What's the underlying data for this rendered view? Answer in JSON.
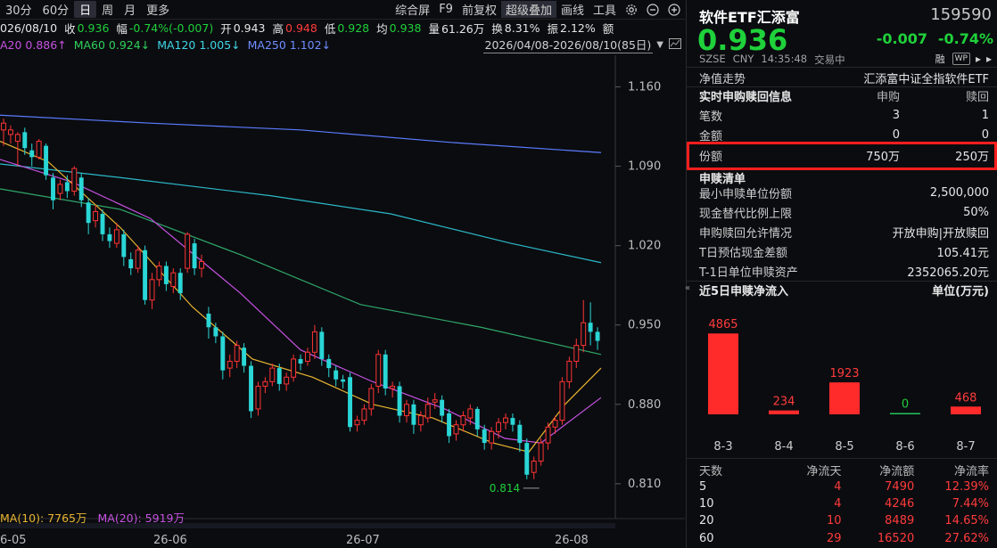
{
  "toolbar": {
    "left_items": [
      "30分",
      "60分",
      "日",
      "周",
      "月",
      "更多"
    ],
    "active_index": 2,
    "right_items": [
      "综合屏",
      "F9",
      "前复权",
      "超级叠加",
      "画线",
      "工具"
    ],
    "highlight_index": 3
  },
  "quote": {
    "date": "026/08/10",
    "close_label": "收",
    "close": "0.936",
    "amp_label": "幅",
    "amp": "-0.74%(-0.007)",
    "open_label": "开",
    "open": "0.943",
    "high_label": "高",
    "high": "0.948",
    "low_label": "低",
    "low": "0.928",
    "avg_label": "均",
    "avg": "0.938",
    "vol_label": "量",
    "vol": "61.26万",
    "turn_label": "换",
    "turn": "8.31%",
    "swing_label": "振",
    "swing": "2.12%",
    "amount_label": "额"
  },
  "ma": {
    "ma20": "A20 0.886↑",
    "ma60": "MA60 0.924↓",
    "ma120": "MA120 1.005↓",
    "ma250": "MA250 1.102↓",
    "range": "2026/04/08-2026/08/10(85日)"
  },
  "volume_ma": {
    "ma10": "MA(10): 7765万",
    "ma20": "MA(20): 5919万"
  },
  "chart_data": {
    "type": "candlestick",
    "y_ticks": [
      "1.160",
      "1.090",
      "1.020",
      "0.950",
      "0.880",
      "0.810"
    ],
    "x_ticks": [
      "6-05",
      "26-06",
      "26-07",
      "26-08"
    ],
    "low_marker": "0.814",
    "ylim": [
      0.795,
      1.18
    ],
    "candles": [
      [
        1.122,
        1.128,
        1.108,
        1.132
      ],
      [
        1.118,
        1.122,
        1.11,
        1.126
      ],
      [
        1.112,
        1.118,
        1.09,
        1.12
      ],
      [
        1.12,
        1.106,
        1.1,
        1.124
      ],
      [
        1.104,
        1.098,
        1.09,
        1.11
      ],
      [
        1.098,
        1.112,
        1.096,
        1.114
      ],
      [
        1.108,
        1.082,
        1.078,
        1.11
      ],
      [
        1.08,
        1.06,
        1.052,
        1.084
      ],
      [
        1.066,
        1.074,
        1.06,
        1.078
      ],
      [
        1.076,
        1.068,
        1.062,
        1.082
      ],
      [
        1.068,
        1.088,
        1.064,
        1.09
      ],
      [
        1.08,
        1.06,
        1.054,
        1.084
      ],
      [
        1.058,
        1.04,
        1.03,
        1.062
      ],
      [
        1.042,
        1.05,
        1.036,
        1.056
      ],
      [
        1.048,
        1.03,
        1.024,
        1.052
      ],
      [
        1.03,
        1.024,
        1.018,
        1.036
      ],
      [
        1.022,
        1.034,
        1.018,
        1.04
      ],
      [
        1.03,
        1.01,
        1.002,
        1.034
      ],
      [
        1.008,
        1.0,
        0.994,
        1.014
      ],
      [
        1.0,
        1.016,
        0.996,
        1.02
      ],
      [
        1.016,
        0.972,
        0.968,
        1.02
      ],
      [
        0.972,
        0.99,
        0.964,
        0.996
      ],
      [
        0.99,
        1.002,
        0.984,
        1.006
      ],
      [
        1.002,
        0.986,
        0.98,
        1.006
      ],
      [
        0.984,
        0.996,
        0.978,
        1.0
      ],
      [
        0.996,
        0.978,
        0.972,
        1.0
      ],
      [
        1.0,
        1.03,
        0.996,
        1.032
      ],
      [
        1.022,
        1.0,
        0.994,
        1.026
      ],
      [
        1.0,
        1.006,
        0.992,
        1.012
      ],
      [
        0.96,
        0.948,
        0.938,
        0.966
      ],
      [
        0.948,
        0.94,
        0.934,
        0.952
      ],
      [
        0.94,
        0.91,
        0.902,
        0.944
      ],
      [
        0.912,
        0.918,
        0.904,
        0.924
      ],
      [
        0.918,
        0.932,
        0.912,
        0.936
      ],
      [
        0.93,
        0.914,
        0.908,
        0.934
      ],
      [
        0.914,
        0.874,
        0.868,
        0.918
      ],
      [
        0.876,
        0.896,
        0.87,
        0.9
      ],
      [
        0.896,
        0.9,
        0.89,
        0.904
      ],
      [
        0.9,
        0.912,
        0.896,
        0.916
      ],
      [
        0.912,
        0.898,
        0.892,
        0.916
      ],
      [
        0.898,
        0.904,
        0.892,
        0.908
      ],
      [
        0.904,
        0.92,
        0.9,
        0.924
      ],
      [
        0.92,
        0.916,
        0.91,
        0.924
      ],
      [
        0.918,
        0.926,
        0.914,
        0.93
      ],
      [
        0.926,
        0.944,
        0.92,
        0.95
      ],
      [
        0.944,
        0.92,
        0.914,
        0.948
      ],
      [
        0.92,
        0.912,
        0.904,
        0.924
      ],
      [
        0.91,
        0.902,
        0.896,
        0.914
      ],
      [
        0.902,
        0.9,
        0.894,
        0.906
      ],
      [
        0.904,
        0.86,
        0.856,
        0.908
      ],
      [
        0.862,
        0.866,
        0.856,
        0.87
      ],
      [
        0.866,
        0.876,
        0.862,
        0.88
      ],
      [
        0.876,
        0.894,
        0.87,
        0.898
      ],
      [
        0.896,
        0.924,
        0.89,
        0.928
      ],
      [
        0.924,
        0.894,
        0.888,
        0.928
      ],
      [
        0.894,
        0.896,
        0.886,
        0.9
      ],
      [
        0.896,
        0.87,
        0.864,
        0.9
      ],
      [
        0.87,
        0.88,
        0.864,
        0.884
      ],
      [
        0.88,
        0.862,
        0.854,
        0.884
      ],
      [
        0.862,
        0.87,
        0.856,
        0.874
      ],
      [
        0.868,
        0.88,
        0.864,
        0.886
      ],
      [
        0.882,
        0.884,
        0.876,
        0.89
      ],
      [
        0.884,
        0.87,
        0.864,
        0.888
      ],
      [
        0.872,
        0.852,
        0.846,
        0.876
      ],
      [
        0.854,
        0.862,
        0.848,
        0.866
      ],
      [
        0.862,
        0.87,
        0.856,
        0.874
      ],
      [
        0.868,
        0.876,
        0.862,
        0.88
      ],
      [
        0.876,
        0.858,
        0.852,
        0.878
      ],
      [
        0.858,
        0.846,
        0.84,
        0.862
      ],
      [
        0.846,
        0.856,
        0.84,
        0.86
      ],
      [
        0.856,
        0.864,
        0.85,
        0.868
      ],
      [
        0.864,
        0.868,
        0.858,
        0.872
      ],
      [
        0.868,
        0.862,
        0.856,
        0.872
      ],
      [
        0.862,
        0.846,
        0.838,
        0.866
      ],
      [
        0.846,
        0.818,
        0.814,
        0.85
      ],
      [
        0.82,
        0.83,
        0.814,
        0.834
      ],
      [
        0.83,
        0.846,
        0.826,
        0.85
      ],
      [
        0.846,
        0.86,
        0.84,
        0.864
      ],
      [
        0.86,
        0.866,
        0.854,
        0.87
      ],
      [
        0.866,
        0.9,
        0.862,
        0.904
      ],
      [
        0.9,
        0.918,
        0.894,
        0.922
      ],
      [
        0.918,
        0.932,
        0.912,
        0.938
      ],
      [
        0.932,
        0.952,
        0.926,
        0.972
      ],
      [
        0.952,
        0.944,
        0.932,
        0.97
      ],
      [
        0.944,
        0.936,
        0.928,
        0.948
      ]
    ],
    "ma_series": [
      {
        "name": "MA250",
        "color": "#5b7cff",
        "values": [
          [
            0,
            1.135
          ],
          [
            0.25,
            1.128
          ],
          [
            0.5,
            1.122
          ],
          [
            0.75,
            1.111
          ],
          [
            1,
            1.102
          ]
        ]
      },
      {
        "name": "MA120",
        "color": "#2bb8c8",
        "values": [
          [
            0,
            1.092
          ],
          [
            0.2,
            1.08
          ],
          [
            0.45,
            1.064
          ],
          [
            0.65,
            1.048
          ],
          [
            0.85,
            1.022
          ],
          [
            1,
            1.005
          ]
        ]
      },
      {
        "name": "MA60",
        "color": "#2fa86a",
        "values": [
          [
            0,
            1.07
          ],
          [
            0.2,
            1.052
          ],
          [
            0.4,
            1.012
          ],
          [
            0.6,
            0.968
          ],
          [
            0.8,
            0.948
          ],
          [
            1,
            0.924
          ]
        ]
      },
      {
        "name": "MA20",
        "color": "#c552e0",
        "values": [
          [
            0,
            1.096
          ],
          [
            0.12,
            1.076
          ],
          [
            0.25,
            1.044
          ],
          [
            0.4,
            0.978
          ],
          [
            0.5,
            0.928
          ],
          [
            0.62,
            0.9
          ],
          [
            0.74,
            0.876
          ],
          [
            0.84,
            0.85
          ],
          [
            0.9,
            0.846
          ],
          [
            1,
            0.886
          ]
        ]
      },
      {
        "name": "MA10",
        "color": "#e8b530",
        "values": [
          [
            0,
            1.112
          ],
          [
            0.08,
            1.094
          ],
          [
            0.2,
            1.036
          ],
          [
            0.32,
            0.966
          ],
          [
            0.42,
            0.92
          ],
          [
            0.52,
            0.904
          ],
          [
            0.62,
            0.88
          ],
          [
            0.72,
            0.868
          ],
          [
            0.82,
            0.846
          ],
          [
            0.88,
            0.838
          ],
          [
            0.94,
            0.88
          ],
          [
            1,
            0.912
          ]
        ]
      }
    ]
  },
  "panel": {
    "name": "软件ETF汇添富",
    "code": "159590",
    "price": "0.936",
    "change": "-0.007",
    "pct": "-0.74%",
    "exchange": "SZSE",
    "currency": "CNY",
    "time": "14:35:48",
    "status": "交易中",
    "badge1": "融",
    "badge2": "WP",
    "nav_label": "净值走势",
    "nav_value": "汇添富中证全指软件ETF",
    "rt_title": "实时申购赎回信息",
    "rt_col_buy": "申购",
    "rt_col_sell": "赎回",
    "rt_rows": [
      {
        "label": "笔数",
        "buy": "3",
        "sell": "1"
      },
      {
        "label": "金额",
        "buy": "0",
        "sell": "0"
      },
      {
        "label": "份额",
        "buy": "750万",
        "sell": "250万"
      }
    ],
    "list_title": "申赎清单",
    "list_rows": [
      {
        "label": "最小申赎单位份额",
        "value": "2,500,000"
      },
      {
        "label": "现金替代比例上限",
        "value": "50%"
      },
      {
        "label": "申购赎回允许情况",
        "value": "开放申购|开放赎回"
      },
      {
        "label": "T日预估现金差额",
        "value": "105.41元"
      },
      {
        "label": "T-1日单位申赎资产",
        "value": "2352065.20元"
      }
    ],
    "flow_title": "近5日申赎净流入",
    "flow_unit": "单位(万元)"
  },
  "flow_chart": {
    "type": "bar",
    "categories": [
      "8-3",
      "8-4",
      "8-5",
      "8-6",
      "8-7"
    ],
    "values": [
      4865,
      234,
      1923,
      0,
      468
    ],
    "labels": [
      "4865",
      "234",
      "1923",
      "0",
      "468"
    ],
    "ylim": [
      0,
      5200
    ]
  },
  "stats": {
    "headers": [
      "天数",
      "净流天",
      "净流额",
      "净流率"
    ],
    "rows": [
      [
        "5",
        "4",
        "7490",
        "12.39%"
      ],
      [
        "10",
        "4",
        "4246",
        "7.44%"
      ],
      [
        "20",
        "10",
        "8489",
        "14.65%"
      ],
      [
        "60",
        "29",
        "16520",
        "27.62%"
      ]
    ]
  }
}
